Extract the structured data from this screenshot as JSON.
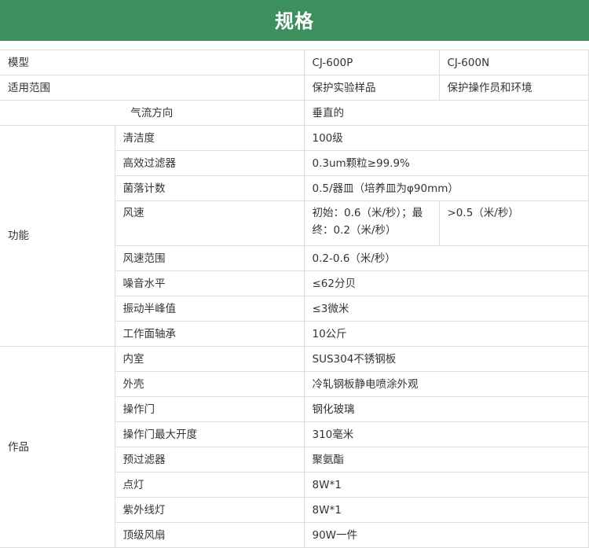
{
  "title": "规格",
  "spec": {
    "model": {
      "label": "模型",
      "p": "CJ-600P",
      "n": "CJ-600N"
    },
    "scope": {
      "label": "适用范围",
      "p": "保护实验样品",
      "n": "保护操作员和环境"
    },
    "airflow": {
      "label": "气流方向",
      "value": "垂直的"
    },
    "function": {
      "group": "功能",
      "rows": [
        {
          "label": "清洁度",
          "value": "100级"
        },
        {
          "label": "高效过滤器",
          "value": "0.3um颗粒≥99.9%"
        },
        {
          "label": "菌落计数",
          "value": "0.5/器皿（培养皿为φ90mm）"
        },
        {
          "label": "风速",
          "p": "初始：0.6（米/秒）；最终：0.2（米/秒）",
          "n": ">0.5（米/秒）"
        },
        {
          "label": "风速范围",
          "value": "0.2-0.6（米/秒）"
        },
        {
          "label": "噪音水平",
          "value": "≤62分贝"
        },
        {
          "label": "振动半峰值",
          "value": "≤3微米"
        },
        {
          "label": "工作面轴承",
          "value": "10公斤"
        }
      ]
    },
    "works": {
      "group": "作品",
      "rows": [
        {
          "label": "内室",
          "value": "SUS304不锈钢板"
        },
        {
          "label": "外壳",
          "value": "冷轧钢板静电喷涂外观"
        },
        {
          "label": "操作门",
          "value": "钢化玻璃"
        },
        {
          "label": "操作门最大开度",
          "value": "310毫米"
        },
        {
          "label": "预过滤器",
          "value": "聚氨酯"
        },
        {
          "label": "点灯",
          "value": "8W*1"
        },
        {
          "label": "紫外线灯",
          "value": "8W*1"
        },
        {
          "label": "顶级风扇",
          "value": "90W一件"
        }
      ]
    }
  }
}
